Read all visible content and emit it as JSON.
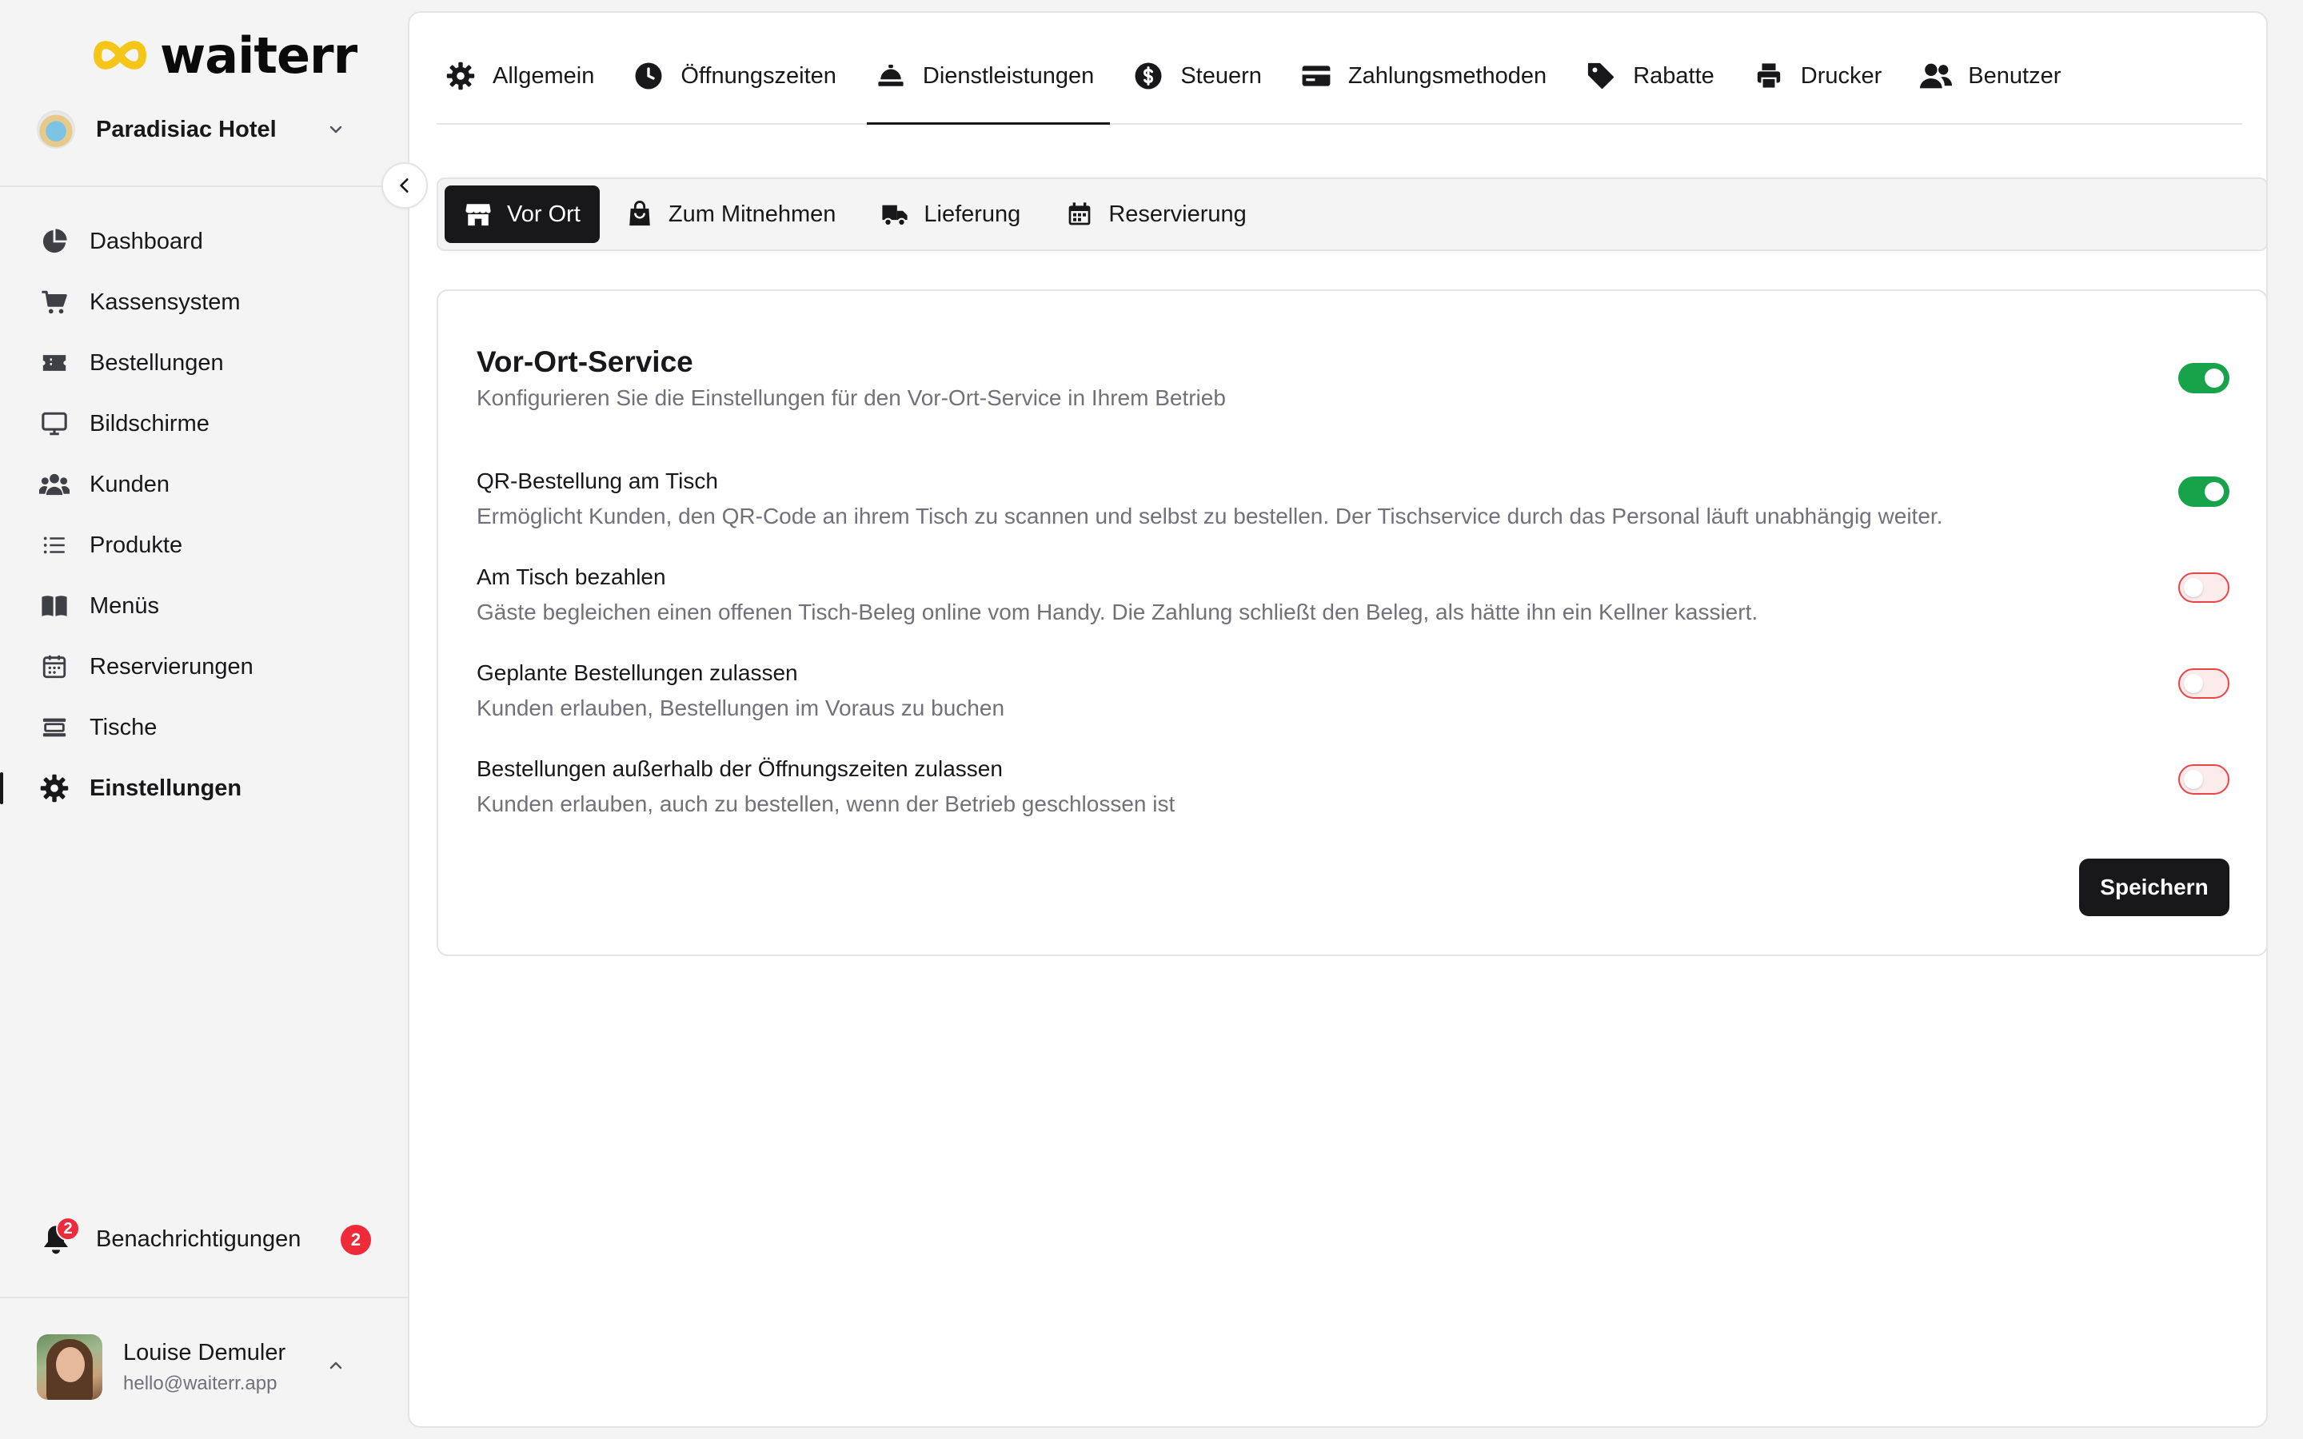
{
  "brand": {
    "name": "waiterr"
  },
  "venue": {
    "name": "Paradisiac Hotel"
  },
  "nav": [
    {
      "label": "Dashboard",
      "icon": "pie-chart-icon",
      "active": false
    },
    {
      "label": "Kassensystem",
      "icon": "cart-icon",
      "active": false
    },
    {
      "label": "Bestellungen",
      "icon": "ticket-icon",
      "active": false
    },
    {
      "label": "Bildschirme",
      "icon": "monitor-icon",
      "active": false
    },
    {
      "label": "Kunden",
      "icon": "users-icon",
      "active": false
    },
    {
      "label": "Produkte",
      "icon": "list-icon",
      "active": false
    },
    {
      "label": "Menüs",
      "icon": "book-icon",
      "active": false
    },
    {
      "label": "Reservierungen",
      "icon": "calendar-icon",
      "active": false
    },
    {
      "label": "Tische",
      "icon": "table-icon",
      "active": false
    },
    {
      "label": "Einstellungen",
      "icon": "gear-icon",
      "active": true
    }
  ],
  "notifications": {
    "label": "Benachrichtigungen",
    "count": "2"
  },
  "user": {
    "name": "Louise Demuler",
    "email": "hello@waiterr.app"
  },
  "top_tabs": [
    {
      "label": "Allgemein",
      "icon": "gear-icon",
      "active": false
    },
    {
      "label": "Öffnungszeiten",
      "icon": "clock-icon",
      "active": false
    },
    {
      "label": "Dienstleistungen",
      "icon": "cloche-icon",
      "active": true
    },
    {
      "label": "Steuern",
      "icon": "dollar-circle-icon",
      "active": false
    },
    {
      "label": "Zahlungsmethoden",
      "icon": "credit-card-icon",
      "active": false
    },
    {
      "label": "Rabatte",
      "icon": "tag-icon",
      "active": false
    },
    {
      "label": "Drucker",
      "icon": "printer-icon",
      "active": false
    },
    {
      "label": "Benutzer",
      "icon": "user-plus-icon",
      "active": false
    }
  ],
  "sub_tabs": [
    {
      "label": "Vor Ort",
      "icon": "store-icon",
      "active": true
    },
    {
      "label": "Zum Mitnehmen",
      "icon": "shopping-bag-icon",
      "active": false
    },
    {
      "label": "Lieferung",
      "icon": "truck-icon",
      "active": false
    },
    {
      "label": "Reservierung",
      "icon": "calendar-icon",
      "active": false
    }
  ],
  "service": {
    "title": "Vor-Ort-Service",
    "description": "Konfigurieren Sie die Einstellungen für den Vor-Ort-Service in Ihrem Betrieb",
    "enabled": true,
    "options": [
      {
        "title": "QR-Bestellung am Tisch",
        "description": "Ermöglicht Kunden, den QR-Code an ihrem Tisch zu scannen und selbst zu bestellen. Der Tischservice durch das Personal läuft unabhängig weiter.",
        "enabled": true
      },
      {
        "title": "Am Tisch bezahlen",
        "description": "Gäste begleichen einen offenen Tisch-Beleg online vom Handy. Die Zahlung schließt den Beleg, als hätte ihn ein Kellner kassiert.",
        "enabled": false
      },
      {
        "title": "Geplante Bestellungen zulassen",
        "description": "Kunden erlauben, Bestellungen im Voraus zu buchen",
        "enabled": false
      },
      {
        "title": "Bestellungen außerhalb der Öffnungszeiten zulassen",
        "description": "Kunden erlauben, auch zu bestellen, wenn der Betrieb geschlossen ist",
        "enabled": false
      }
    ],
    "save_label": "Speichern"
  },
  "colors": {
    "accent": "#18181b",
    "toggle_on": "#16a34a",
    "toggle_off_border": "#ef4444",
    "badge": "#ef2b3a",
    "logo_yellow": "#f5c518"
  }
}
